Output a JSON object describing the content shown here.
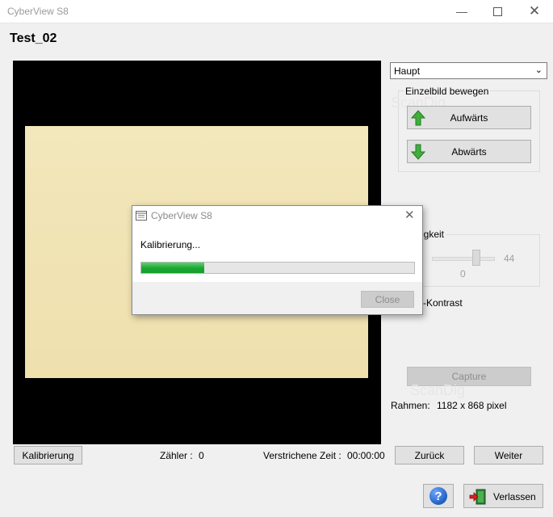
{
  "window": {
    "title": "CyberView S8"
  },
  "document": {
    "title": "Test_02"
  },
  "mode_select": {
    "value": "Haupt"
  },
  "move_group": {
    "label": "Einzelbild bewegen",
    "up_label": "Aufwärts",
    "down_label": "Abwärts"
  },
  "watermark": "ScanDig",
  "brightness": {
    "label_partial": "igkeit",
    "value": "44",
    "zero": "0",
    "slider_fraction": 0.7
  },
  "contrast": {
    "label_partial": "-Kontrast"
  },
  "capture": {
    "label": "Capture"
  },
  "frame_info": {
    "label": "Rahmen:",
    "value": "1182 x 868 pixel"
  },
  "bottom": {
    "calibration_label": "Kalibrierung",
    "counter_label": "Zähler :",
    "counter_value": "0",
    "elapsed_label": "Verstrichene Zeit :",
    "elapsed_value": "00:00:00",
    "back_label": "Zurück",
    "next_label": "Weiter",
    "help_label": "?",
    "exit_label": "Verlassen"
  },
  "dialog": {
    "title": "CyberView S8",
    "message": "Kalibrierung...",
    "progress_percent": 23,
    "close_label": "Close"
  },
  "colors": {
    "accent_green": "#1aa532",
    "help_blue": "#1f5fbf",
    "exit_red": "#d62020"
  }
}
